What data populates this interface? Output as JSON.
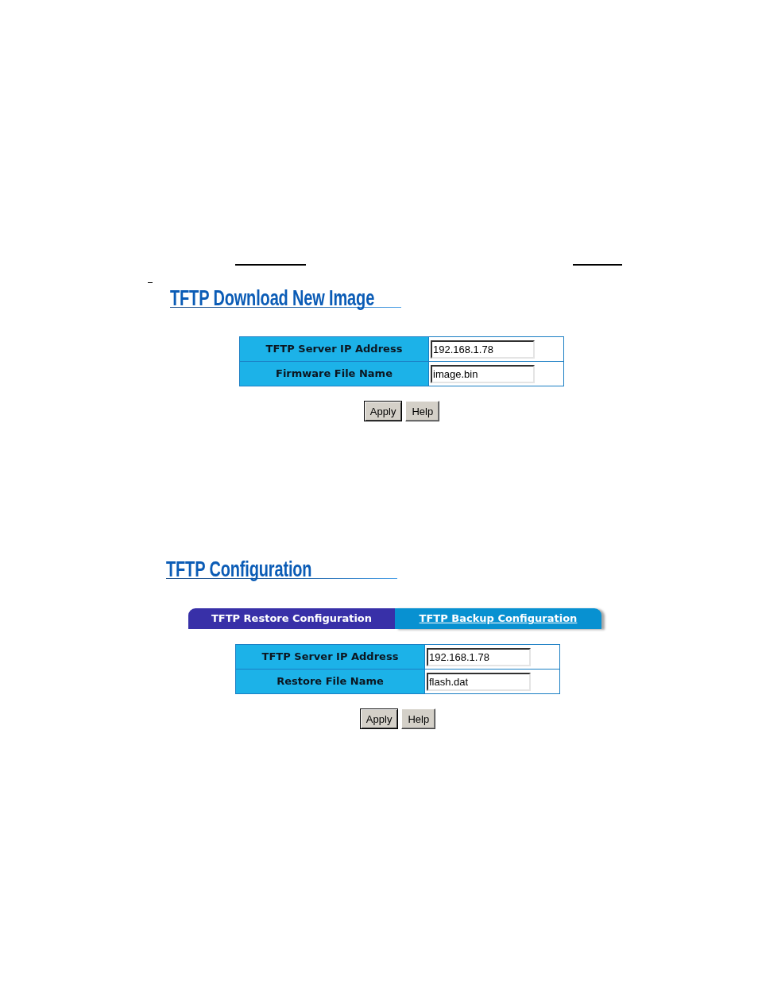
{
  "sections": [
    {
      "heading": "TFTP Download New Image",
      "fields": [
        {
          "label": "TFTP Server IP Address",
          "value": "192.168.1.78"
        },
        {
          "label": "Firmware File Name",
          "value": "image.bin"
        }
      ],
      "buttons": [
        {
          "label": "Apply",
          "default": true
        },
        {
          "label": "Help",
          "default": false
        }
      ]
    },
    {
      "heading": "TFTP Configuration",
      "tabs": [
        {
          "label": "TFTP Restore Configuration",
          "selected": true
        },
        {
          "label": "TFTP Backup Configuration",
          "selected": false
        }
      ],
      "fields": [
        {
          "label": "TFTP Server IP Address",
          "value": "192.168.1.78"
        },
        {
          "label": "Restore File Name",
          "value": "flash.dat"
        }
      ],
      "buttons": [
        {
          "label": "Apply",
          "default": true
        },
        {
          "label": "Help",
          "default": false
        }
      ]
    }
  ]
}
